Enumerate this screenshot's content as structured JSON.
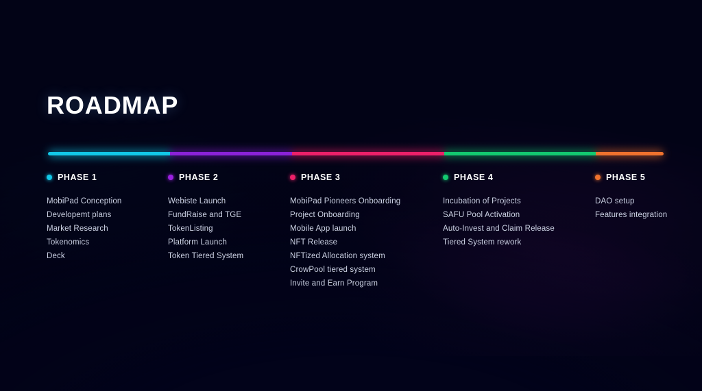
{
  "page": {
    "title": "ROADMAP",
    "background_color": "#02031a",
    "accent_left_glow": "#177daa",
    "accent_right_glow": "#982096"
  },
  "timeline": {
    "segments": [
      {
        "name": "phase-1-segment",
        "color": "#12c8e8",
        "width_pct": 19.8
      },
      {
        "name": "phase-2-segment",
        "color": "#8b22d8",
        "width_pct": 19.8
      },
      {
        "name": "phase-3-segment",
        "color": "#ec2069",
        "width_pct": 24.8
      },
      {
        "name": "phase-4-segment",
        "color": "#13c970",
        "width_pct": 24.6
      },
      {
        "name": "phase-5-segment",
        "color": "#f0722e",
        "width_pct": 11.0
      }
    ]
  },
  "phases": [
    {
      "label": "PHASE 1",
      "color": "#12c8e8",
      "items": [
        "MobiPad Conception",
        "Developemt plans",
        "Market Research",
        "Tokenomics",
        "Deck"
      ]
    },
    {
      "label": "PHASE 2",
      "color": "#9b20e0",
      "items": [
        "Webiste Launch",
        "FundRaise and TGE",
        "TokenListing",
        "Platform Launch",
        "Token Tiered System"
      ]
    },
    {
      "label": "PHASE 3",
      "color": "#ec2069",
      "items": [
        "MobiPad Pioneers Onboarding",
        "Project Onboarding",
        "Mobile App launch",
        "NFT Release",
        "NFTized Allocation system",
        "CrowPool tiered system",
        "Invite and Earn Program"
      ]
    },
    {
      "label": "PHASE 4",
      "color": "#13c970",
      "items": [
        "Incubation of Projects",
        "SAFU Pool Activation",
        "Auto-Invest and Claim Release",
        "Tiered System rework"
      ]
    },
    {
      "label": "PHASE 5",
      "color": "#f0722e",
      "items": [
        "DAO setup",
        "Features integration"
      ]
    }
  ]
}
